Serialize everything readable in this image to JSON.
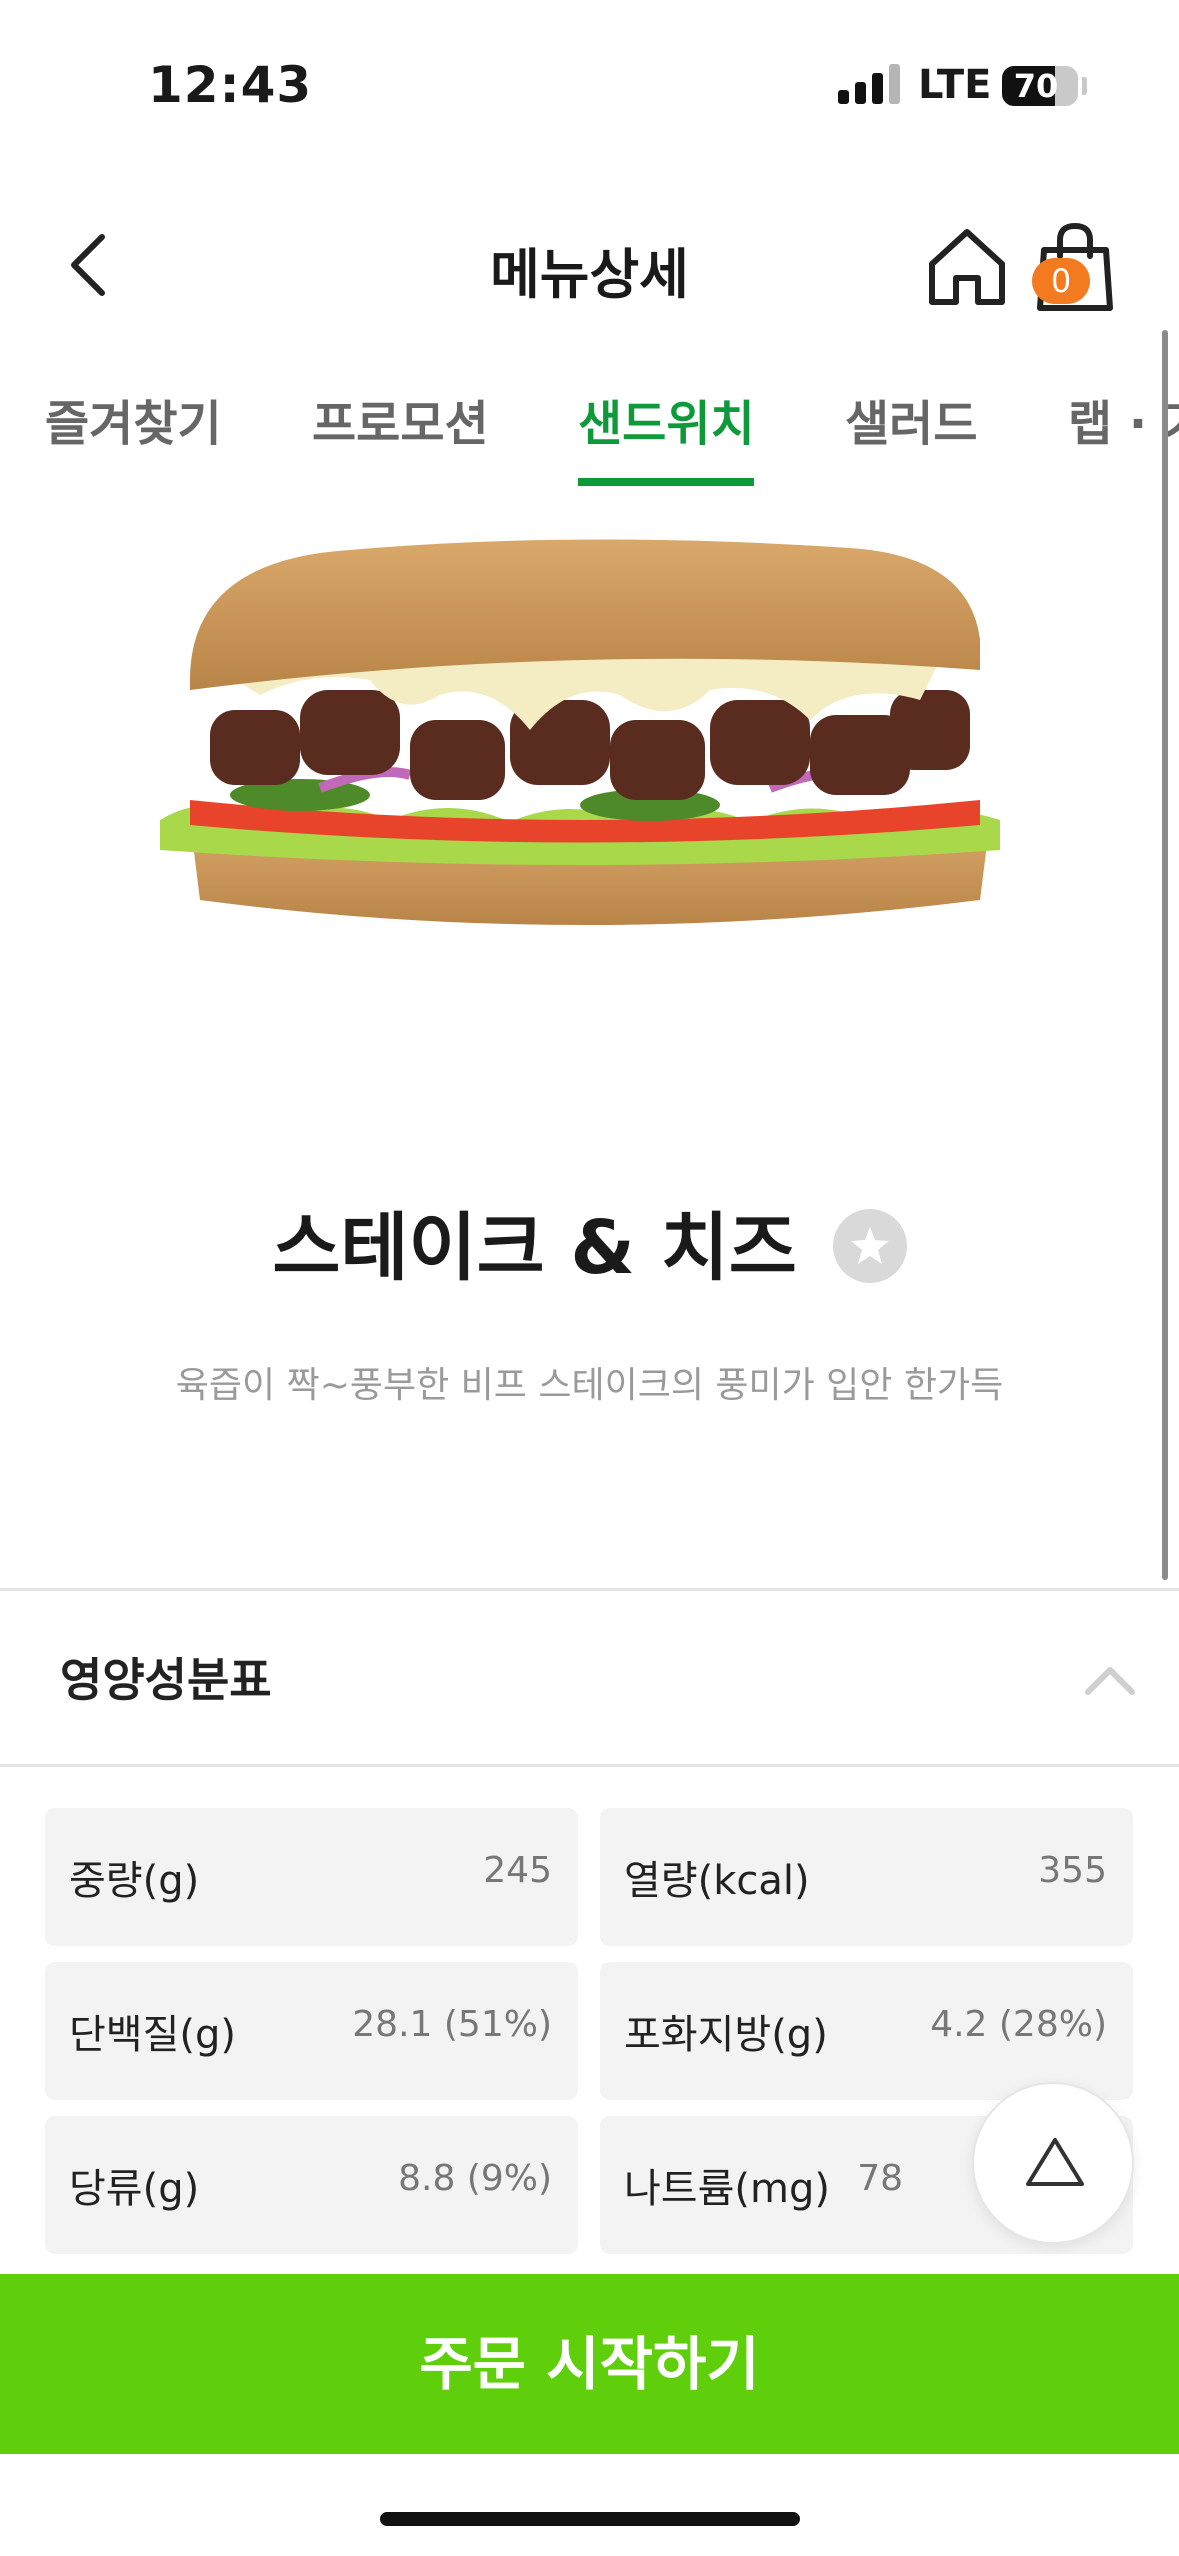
{
  "status_bar": {
    "time": "12:43",
    "network": "LTE",
    "battery": "70",
    "battery_level": 0.7
  },
  "header": {
    "title": "메뉴상세",
    "cart_count": "0",
    "icons": [
      "back-icon",
      "home-icon",
      "shopping-bag-icon"
    ]
  },
  "tabs": [
    {
      "label": "즐겨찾기",
      "active": false
    },
    {
      "label": "프로모션",
      "active": false
    },
    {
      "label": "샌드위치",
      "active": true
    },
    {
      "label": "샐러드",
      "active": false
    },
    {
      "label": "랩 · 기",
      "active": false
    }
  ],
  "product": {
    "name": "스테이크 & 치즈",
    "description": "육즙이 짝~풍부한 비프 스테이크의 풍미가 입안 한가득"
  },
  "nutrition": {
    "title": "영양성분표",
    "items": [
      {
        "label": "중량(g)",
        "value": "245"
      },
      {
        "label": "열량(kcal)",
        "value": "355"
      },
      {
        "label": "단백질(g)",
        "value": "28.1 (51%)"
      },
      {
        "label": "포화지방(g)",
        "value": "4.2 (28%)"
      },
      {
        "label": "당류(g)",
        "value": "8.8 (9%)"
      },
      {
        "label": "나트륨(mg)",
        "value": "78"
      }
    ]
  },
  "order_button": "주문 시작하기",
  "colors": {
    "accent_green": "#0e9a3a",
    "order_green": "#5fcf0c",
    "badge_orange": "#f47a20"
  }
}
